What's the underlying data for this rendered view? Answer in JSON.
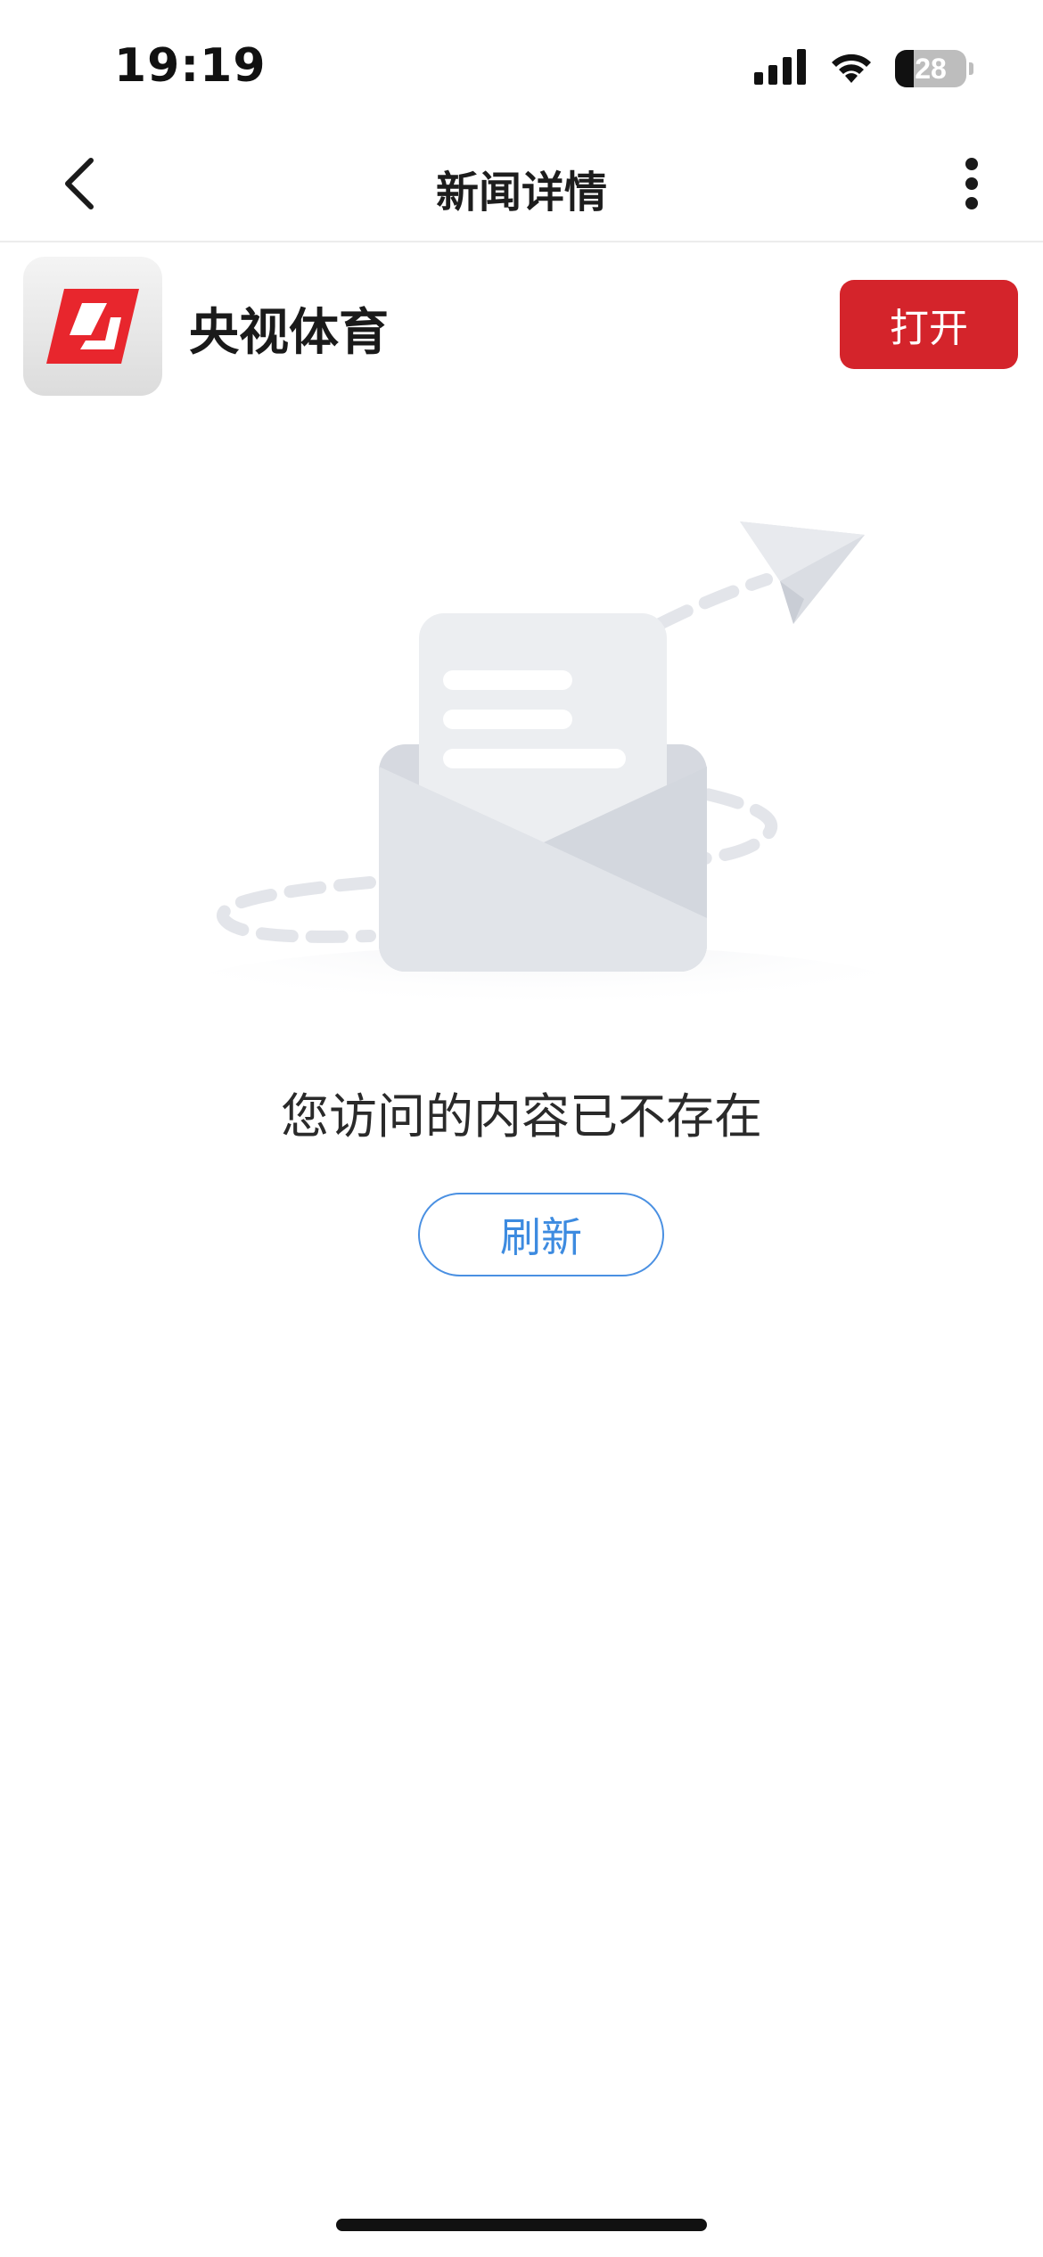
{
  "status_bar": {
    "time": "19:19",
    "battery": "28",
    "icons": [
      "cellular-signal-icon",
      "wifi-icon",
      "battery-icon"
    ]
  },
  "nav": {
    "title": "新闻详情",
    "back_icon": "chevron-left-icon",
    "more_icon": "more-vertical-icon"
  },
  "app_banner": {
    "app_name": "央视体育",
    "open_label": "打开",
    "logo_color": "#e8262d",
    "button_color": "#d4242b"
  },
  "empty_state": {
    "illustration": "envelope-paper-plane-illustration",
    "message": "您访问的内容已不存在",
    "refresh_label": "刷新",
    "accent_color": "#4a90e2"
  }
}
